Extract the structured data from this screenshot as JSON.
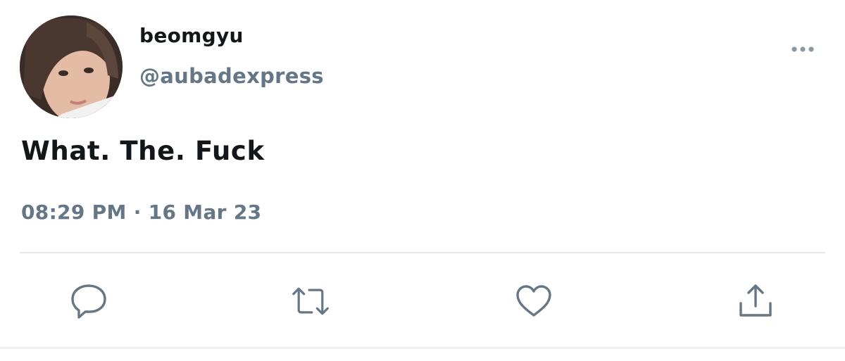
{
  "user": {
    "display_name": "beomgyu",
    "handle": "@aubadexpress"
  },
  "tweet": {
    "text": "What. The. Fuck",
    "timestamp": "08:29 PM · 16 Mar 23"
  },
  "icons": {
    "more": "more-options-icon",
    "reply": "reply-icon",
    "retweet": "retweet-icon",
    "like": "heart-icon",
    "share": "share-icon"
  },
  "colors": {
    "text_primary": "#14171a",
    "text_secondary": "#657786",
    "divider": "#e1e8ed"
  }
}
